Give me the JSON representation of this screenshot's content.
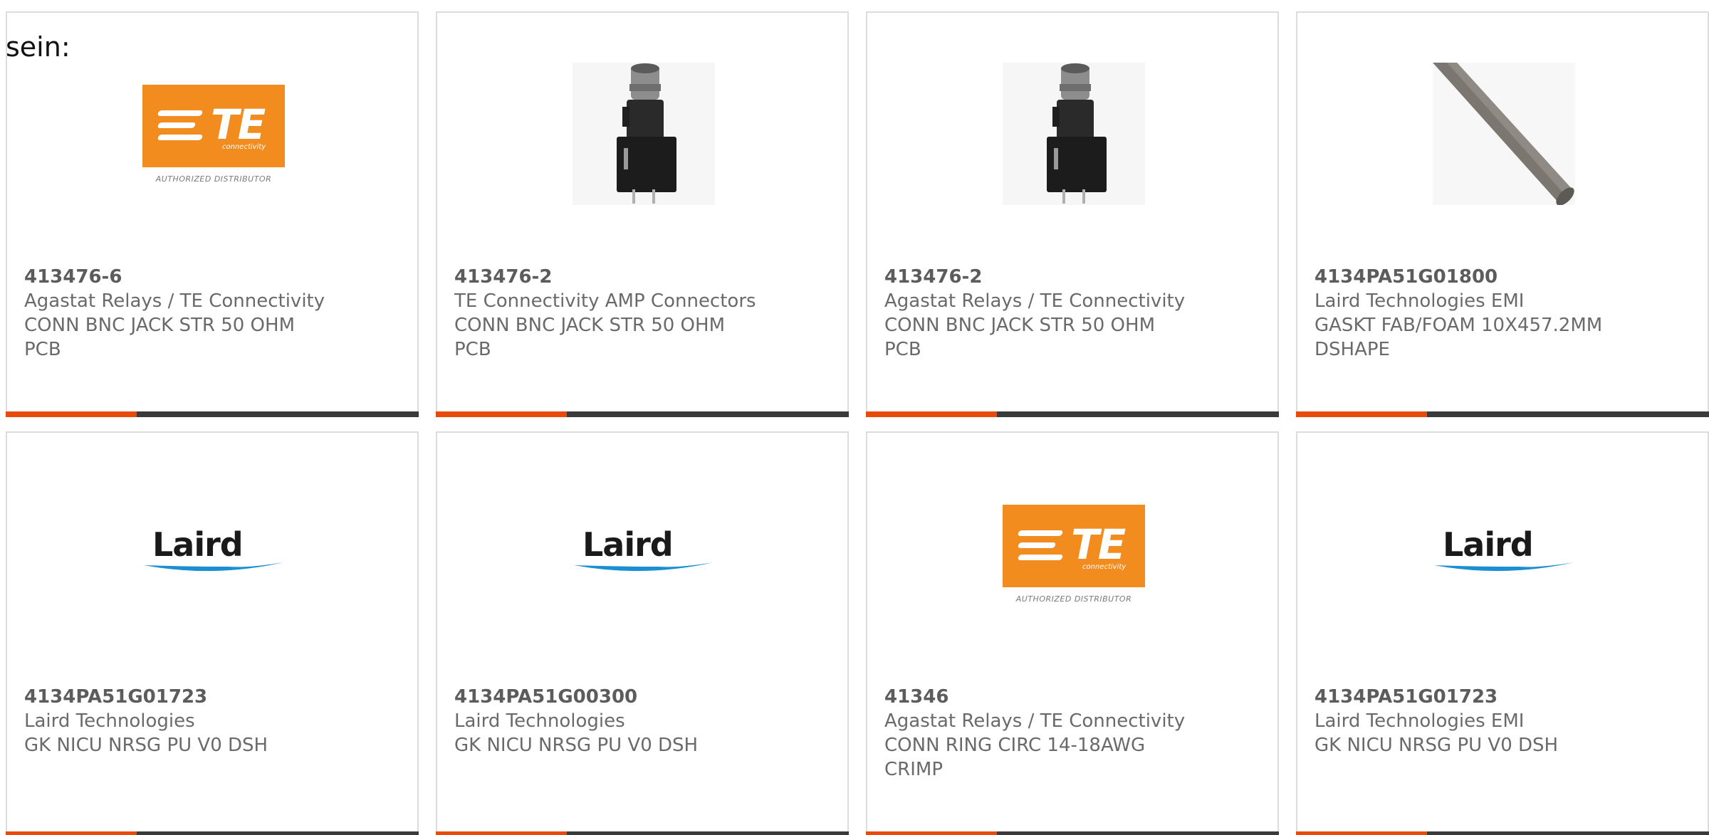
{
  "page": {
    "lead_text": "sein:"
  },
  "products": [
    {
      "part_number": "413476-6",
      "manufacturer": "Agastat Relays / TE Connectivity",
      "description_1": "CONN BNC JACK STR 50 OHM",
      "description_2": "PCB",
      "image": "te-logo"
    },
    {
      "part_number": "413476-2",
      "manufacturer": "TE Connectivity AMP Connectors",
      "description_1": "CONN BNC JACK STR 50 OHM",
      "description_2": "PCB",
      "image": "bnc-connector"
    },
    {
      "part_number": "413476-2",
      "manufacturer": "Agastat Relays / TE Connectivity",
      "description_1": "CONN BNC JACK STR 50 OHM",
      "description_2": "PCB",
      "image": "bnc-connector"
    },
    {
      "part_number": "4134PA51G01800",
      "manufacturer": "Laird Technologies EMI",
      "description_1": "GASKT FAB/FOAM 10X457.2MM",
      "description_2": "DSHAPE",
      "image": "gasket-strip"
    },
    {
      "part_number": "4134PA51G01723",
      "manufacturer": "Laird Technologies",
      "description_1": "GK NICU NRSG PU V0 DSH",
      "description_2": "",
      "image": "laird-logo"
    },
    {
      "part_number": "4134PA51G00300",
      "manufacturer": "Laird Technologies",
      "description_1": "GK NICU NRSG PU V0 DSH",
      "description_2": "",
      "image": "laird-logo"
    },
    {
      "part_number": "41346",
      "manufacturer": "Agastat Relays / TE Connectivity",
      "description_1": "CONN RING CIRC 14-18AWG",
      "description_2": "CRIMP",
      "image": "te-logo"
    },
    {
      "part_number": "4134PA51G01723",
      "manufacturer": "Laird Technologies EMI",
      "description_1": "GK NICU NRSG PU V0 DSH",
      "description_2": "",
      "image": "laird-logo"
    }
  ],
  "logos": {
    "te_letters": "TE",
    "te_sub": "connectivity",
    "te_distributor": "AUTHORIZED DISTRIBUTOR",
    "laird_word": "Laird"
  },
  "colors": {
    "accent_bar": "#e84a0c",
    "dark_bar": "#3a3a3a",
    "te_orange": "#f28c1e",
    "laird_blue": "#1b8fd2",
    "text_gray": "#6a6a6a"
  }
}
